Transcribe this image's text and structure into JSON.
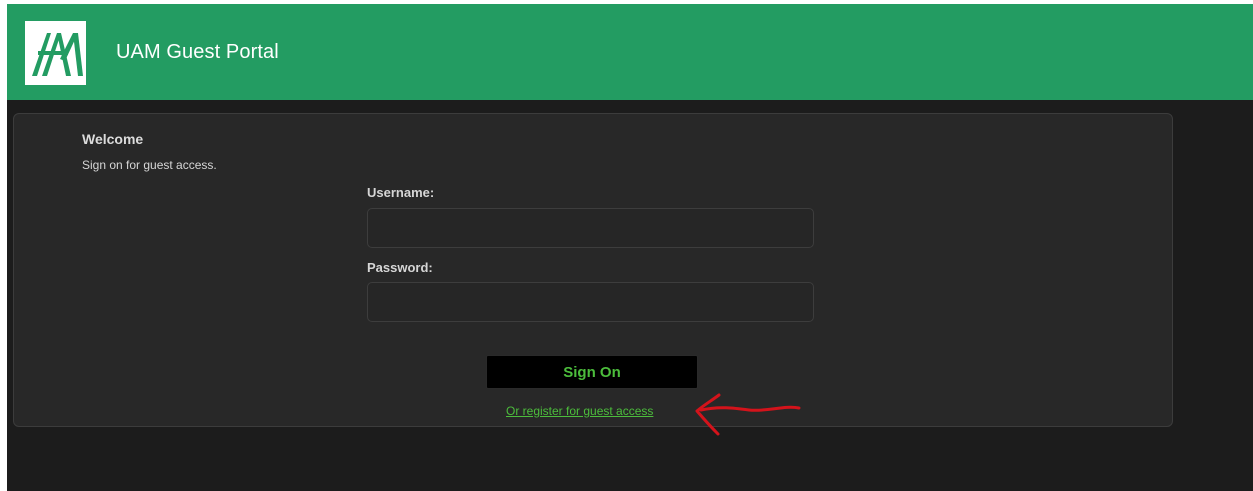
{
  "header": {
    "title": "UAM Guest Portal",
    "logo_icon": "uam-logo-icon",
    "background_color": "#239c62"
  },
  "welcome": {
    "title": "Welcome",
    "subtitle": "Sign on for guest access."
  },
  "form": {
    "username_label": "Username:",
    "username_value": "",
    "password_label": "Password:",
    "password_value": "",
    "submit_label": "Sign On",
    "register_link": "Or register for guest access"
  },
  "annotation": {
    "icon": "red-arrow-icon",
    "color": "#d4131b"
  },
  "colors": {
    "accent_green": "#4cbd3c",
    "page_background": "#1c1c1c",
    "panel_background": "#282828"
  }
}
